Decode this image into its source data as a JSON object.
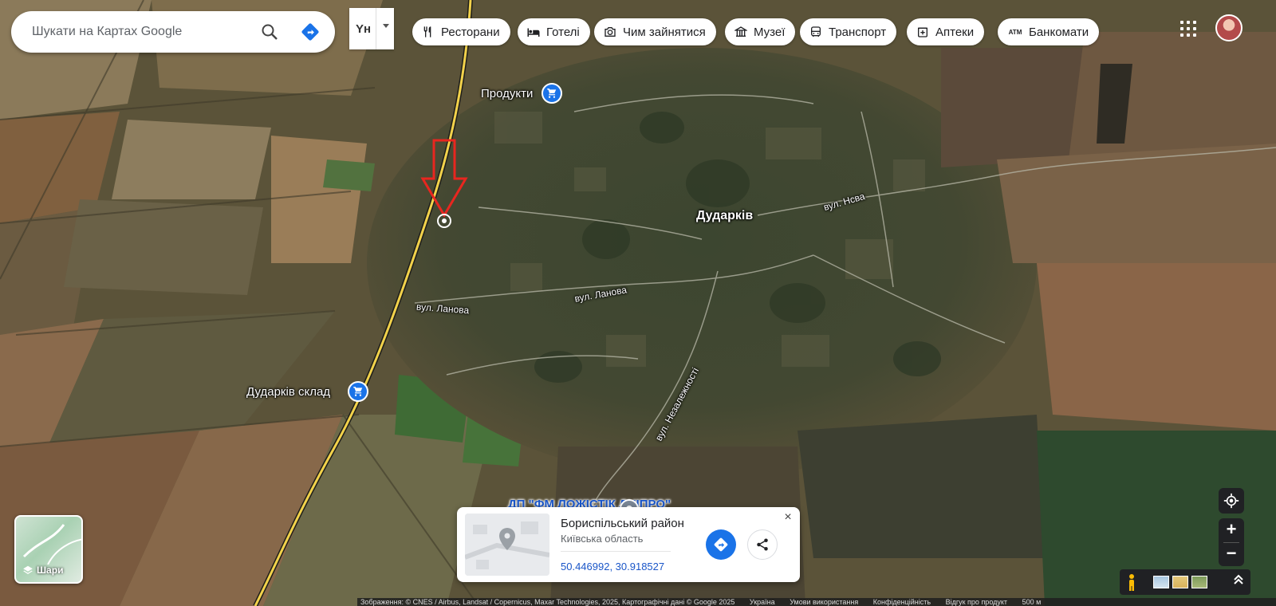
{
  "search": {
    "placeholder": "Шукати на Картах Google"
  },
  "lang_selector": {
    "label": "Yн"
  },
  "chips": [
    {
      "label": "Ресторани",
      "icon": "fork-knife-icon"
    },
    {
      "label": "Готелі",
      "icon": "bed-icon"
    },
    {
      "label": "Чим зайнятися",
      "icon": "camera-icon"
    },
    {
      "label": "Музеї",
      "icon": "museum-icon"
    },
    {
      "label": "Транспорт",
      "icon": "bus-icon"
    },
    {
      "label": "Аптеки",
      "icon": "pharmacy-icon"
    },
    {
      "label": "Банкомати",
      "icon": "atm-icon",
      "icon_text": "ATM"
    }
  ],
  "map": {
    "town": "Дударків",
    "streets": [
      "вул. Нсва",
      "вул. Ланова",
      "вул. Ланова",
      "вул. Незалежності"
    ],
    "pois": [
      {
        "label": "Продукти",
        "icon": "shopping-cart-icon"
      },
      {
        "label": "Дударків склад",
        "icon": "shopping-cart-icon"
      }
    ],
    "company": {
      "label": "ДП \"ФМ ЛОЖІСТІК ДНІПРО\"",
      "icon": "place-pin-icon"
    },
    "marker_color": "#e8261f"
  },
  "layers": {
    "label": "Шари"
  },
  "info_card": {
    "title": "Бориспільський район",
    "subtitle": "Київська область",
    "coordinates": "50.446992, 30.918527",
    "close": "×"
  },
  "zoom": {
    "in": "+",
    "out": "−"
  },
  "footer": {
    "imagery": "Зображення: © CNES / Airbus, Landsat / Copernicus, Maxar Technologies, 2025, Картографічні дані © Google 2025",
    "links": [
      "Україна",
      "Умови використання",
      "Конфіденційність",
      "Відгук про продукт"
    ],
    "scale": "500 м"
  },
  "colors": {
    "accent": "#1a73e8",
    "road": "#f2d24b"
  }
}
